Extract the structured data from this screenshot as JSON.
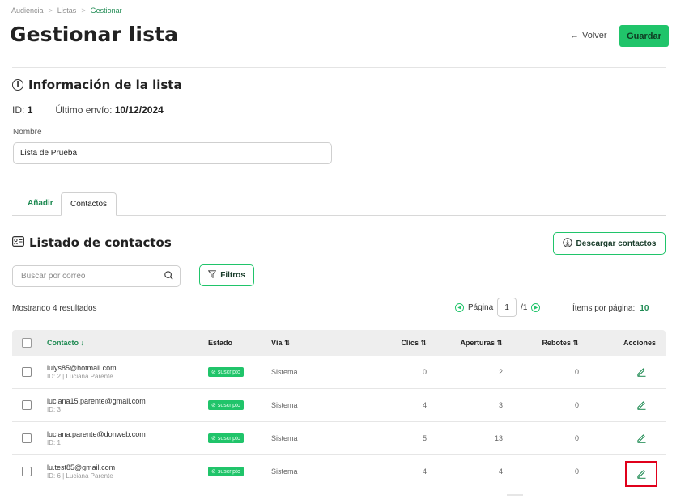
{
  "breadcrumb": {
    "items": [
      "Audiencia",
      "Listas",
      "Gestionar"
    ]
  },
  "header": {
    "title": "Gestionar lista",
    "back_label": "Volver",
    "save_label": "Guardar"
  },
  "info": {
    "section_title": "Información de la lista",
    "id_label": "ID:",
    "id_value": "1",
    "last_send_label": "Último envío:",
    "last_send_value": "10/12/2024",
    "name_label": "Nombre",
    "name_value": "Lista de Prueba"
  },
  "tabs": [
    {
      "label": "Añadir"
    },
    {
      "label": "Contactos",
      "active": true
    }
  ],
  "contacts": {
    "title": "Listado de contactos",
    "download_label": "Descargar contactos",
    "search_placeholder": "Buscar por correo",
    "filters_label": "Filtros",
    "results_text": "Mostrando 4 resultados",
    "pagination": {
      "page_label": "Página",
      "page": "1",
      "total": "/1",
      "items_label": "Ítems por página:",
      "items_value": "10"
    }
  },
  "table": {
    "headers": {
      "contact": "Contacto ↓",
      "status": "Estado",
      "via": "Vía ⇅",
      "clicks": "Clics ⇅",
      "opens": "Aperturas ⇅",
      "bounces": "Rebotes ⇅",
      "actions": "Acciones"
    },
    "rows": [
      {
        "email": "lulys85@hotmail.com",
        "sub": "ID: 2 | Luciana Parente",
        "status": "suscripto",
        "via": "Sistema",
        "clicks": "0",
        "opens": "2",
        "bounces": "0"
      },
      {
        "email": "luciana15.parente@gmail.com",
        "sub": "ID: 3",
        "status": "suscripto",
        "via": "Sistema",
        "clicks": "4",
        "opens": "3",
        "bounces": "0"
      },
      {
        "email": "luciana.parente@donweb.com",
        "sub": "ID: 1",
        "status": "suscripto",
        "via": "Sistema",
        "clicks": "5",
        "opens": "13",
        "bounces": "0"
      },
      {
        "email": "lu.test85@gmail.com",
        "sub": "ID: 6 | Luciana Parente",
        "status": "suscripto",
        "via": "Sistema",
        "clicks": "4",
        "opens": "4",
        "bounces": "0"
      }
    ]
  },
  "colors": {
    "accent": "#20c46a",
    "accent_text": "#1e8a52",
    "highlight": "#e0001b"
  },
  "icons": [
    "chevron-right-icon",
    "arrow-left-icon",
    "info-icon",
    "list-icon",
    "download-icon",
    "search-icon",
    "filter-icon",
    "arrow-circle-left-icon",
    "arrow-circle-right-icon",
    "check-circle-icon",
    "edit-icon"
  ]
}
